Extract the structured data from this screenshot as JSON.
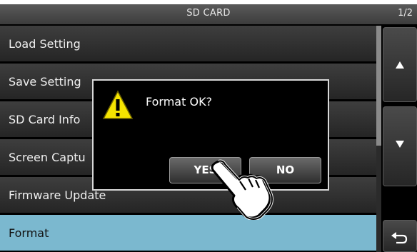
{
  "header": {
    "title": "SD CARD",
    "page": "1/2"
  },
  "menu": {
    "items": [
      {
        "label": "Load Setting"
      },
      {
        "label": "Save Setting"
      },
      {
        "label": "SD Card Info"
      },
      {
        "label": "Screen Captu"
      },
      {
        "label": "Firmware Update"
      },
      {
        "label": "Format"
      }
    ],
    "selected_index": 5
  },
  "sidebar": {
    "up_icon": "triangle-up-icon",
    "down_icon": "triangle-down-icon",
    "back_icon": "return-arrow-icon"
  },
  "dialog": {
    "message": "Format OK?",
    "icon": "warning-icon",
    "yes_label": "YES",
    "no_label": "NO"
  },
  "colors": {
    "selected_row": "#7bb8cf",
    "warning": "#f5e400"
  }
}
